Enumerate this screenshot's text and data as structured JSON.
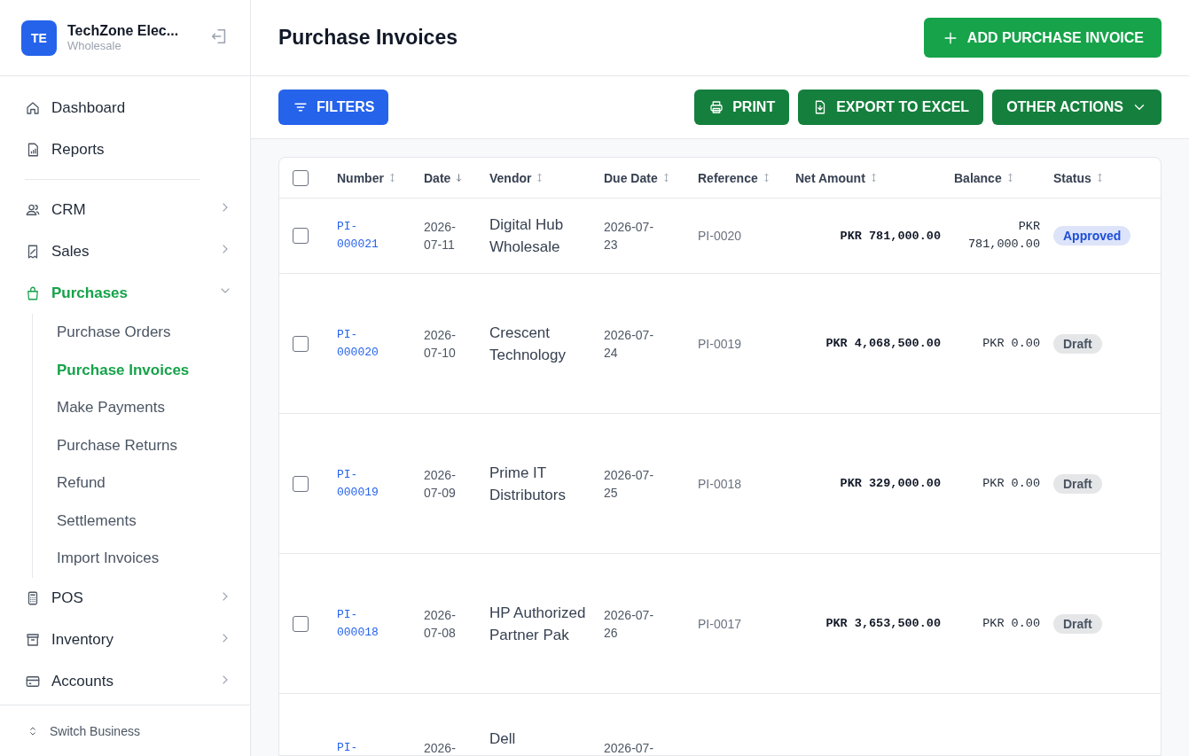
{
  "business": {
    "initials": "TE",
    "name": "TechZone Elec...",
    "type": "Wholesale"
  },
  "nav": [
    {
      "label": "Dashboard",
      "kind": "link",
      "selected": false
    },
    {
      "label": "Reports",
      "kind": "link",
      "selected": false
    },
    {
      "kind": "divider"
    },
    {
      "label": "CRM",
      "kind": "group",
      "expanded": false,
      "selected": false
    },
    {
      "label": "Sales",
      "kind": "group",
      "expanded": false,
      "selected": false
    },
    {
      "label": "Purchases",
      "kind": "group",
      "expanded": true,
      "selected": true,
      "children": [
        {
          "label": "Purchase Orders",
          "selected": false
        },
        {
          "label": "Purchase Invoices",
          "selected": true
        },
        {
          "label": "Make Payments",
          "selected": false
        },
        {
          "label": "Purchase Returns",
          "selected": false
        },
        {
          "label": "Refund",
          "selected": false
        },
        {
          "label": "Settlements",
          "selected": false
        },
        {
          "label": "Import Invoices",
          "selected": false
        }
      ]
    },
    {
      "label": "POS",
      "kind": "group",
      "expanded": false,
      "selected": false
    },
    {
      "label": "Inventory",
      "kind": "group",
      "expanded": false,
      "selected": false
    },
    {
      "label": "Accounts",
      "kind": "group",
      "expanded": false,
      "selected": false
    }
  ],
  "switch_business": "Switch Business",
  "page_title": "Purchase Invoices",
  "add_button": "ADD PURCHASE INVOICE",
  "filters_button": "FILTERS",
  "actions": [
    "PRINT",
    "EXPORT TO EXCEL",
    "OTHER ACTIONS"
  ],
  "table": {
    "select_all": false,
    "columns": [
      {
        "label": "Number",
        "sorted": false
      },
      {
        "label": "Date",
        "sorted": true
      },
      {
        "label": "Vendor",
        "sorted": false
      },
      {
        "label": "Due Date",
        "sorted": false
      },
      {
        "label": "Reference",
        "sorted": false
      },
      {
        "label": "Net Amount",
        "sorted": false
      },
      {
        "label": "Balance",
        "sorted": false
      },
      {
        "label": "Status",
        "sorted": false
      }
    ],
    "rows": [
      {
        "checked": false,
        "number": "PI-000021",
        "date": "2026-07-11",
        "vendor": "Digital Hub Wholesale",
        "due_date": "2026-07-23",
        "reference": "PI-0020",
        "net_amount": "PKR 781,000.00",
        "balance": "PKR 781,000.00",
        "status": "Approved",
        "color": "#1d4ed8"
      },
      {
        "checked": false,
        "number": "PI-000020",
        "date": "2026-07-10",
        "vendor": "Crescent Technology",
        "due_date": "2026-07-24",
        "reference": "PI-0019",
        "net_amount": "PKR 4,068,500.00",
        "balance": "PKR 0.00",
        "status": "Draft",
        "color": "#4b5563"
      },
      {
        "checked": false,
        "number": "PI-000019",
        "date": "2026-07-09",
        "vendor": "Prime IT Distributors",
        "due_date": "2026-07-25",
        "reference": "PI-0018",
        "net_amount": "PKR 329,000.00",
        "balance": "PKR 0.00",
        "status": "Draft",
        "color": "#4b5563"
      },
      {
        "checked": false,
        "number": "PI-000018",
        "date": "2026-07-08",
        "vendor": "HP Authorized Partner Pak",
        "due_date": "2026-07-26",
        "reference": "PI-0017",
        "net_amount": "PKR 3,653,500.00",
        "balance": "PKR 0.00",
        "status": "Draft",
        "color": "#4b5563"
      },
      {
        "number": "PI-",
        "date": "2026-",
        "vendor": "Dell",
        "due_date": "2026-07-"
      }
    ]
  }
}
